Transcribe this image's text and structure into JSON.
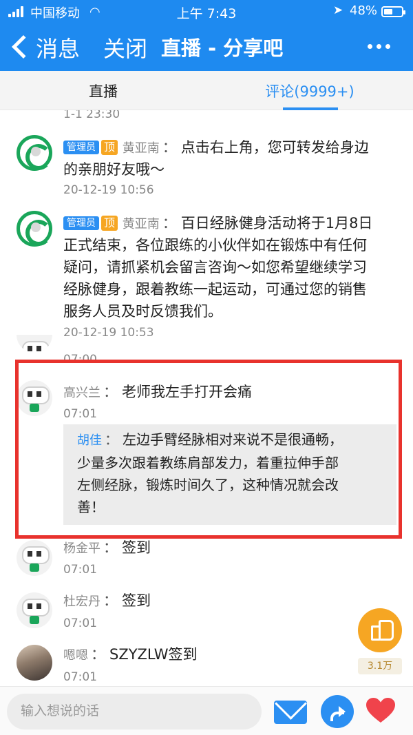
{
  "status_bar": {
    "carrier": "中国移动",
    "time": "上午 7:43",
    "battery": "48%",
    "battery_level": 0.48
  },
  "nav": {
    "back_label": "消息",
    "close_label": "关闭",
    "title": "直播 - 分享吧"
  },
  "tabs": [
    {
      "label": "直播",
      "active": false
    },
    {
      "label": "评论(9999+)",
      "active": true
    }
  ],
  "comments": {
    "partial_top_time": "1-1 23:30",
    "c1": {
      "admin_badge": "管理员",
      "top_badge": "顶",
      "name": "黄亚南",
      "sep": "：",
      "text_l1": "点击右上角，您可转发给身边",
      "text_l2": "的亲朋好友哦～",
      "time": "20-12-19 10:56"
    },
    "c2": {
      "admin_badge": "管理员",
      "top_badge": "顶",
      "name": "黄亚南",
      "sep": "：",
      "text_l1": "百日经脉健身活动将于1月8日",
      "text_l2": "正式结束，各位跟练的小伙伴如在锻炼中有任何",
      "text_l3": "疑问，请抓紧机会留言咨询～如您希望继续学习",
      "text_l4": "经脉健身，跟着教练一起运动，可通过您的销售",
      "text_l5": "服务人员及时反馈我们。",
      "time": "20-12-19 10:53"
    },
    "partial_mid_time": "07:00",
    "c3": {
      "name": "高兴兰",
      "sep": "：",
      "text": "老师我左手打开会痛",
      "time": "07:01",
      "reply": {
        "name": "胡佳",
        "sep": "：",
        "text_l1": "左边手臂经脉相对来说不是很通畅，",
        "text_l2": "少量多次跟着教练肩部发力，着重拉伸手部",
        "text_l3": "左侧经脉，锻炼时间久了，这种情况就会改",
        "text_l4": "善！"
      }
    },
    "c4": {
      "name": "杨金平",
      "sep": "：",
      "text": "签到",
      "time": "07:01"
    },
    "c5": {
      "name": "杜宏丹",
      "sep": "：",
      "text": "签到",
      "time": "07:01"
    },
    "c6": {
      "name": "嗯嗯",
      "sep": "：",
      "text": "SZYZLW签到",
      "time": "07:01"
    }
  },
  "like": {
    "count": "3.1万"
  },
  "bottom_bar": {
    "input_placeholder": "输入想说的话"
  },
  "colors": {
    "header_blue": "#1e8af0",
    "accent_blue": "#2b8ff2",
    "highlight_red": "#e8322d",
    "like_orange": "#f6a623",
    "heart_red": "#f0434b"
  }
}
